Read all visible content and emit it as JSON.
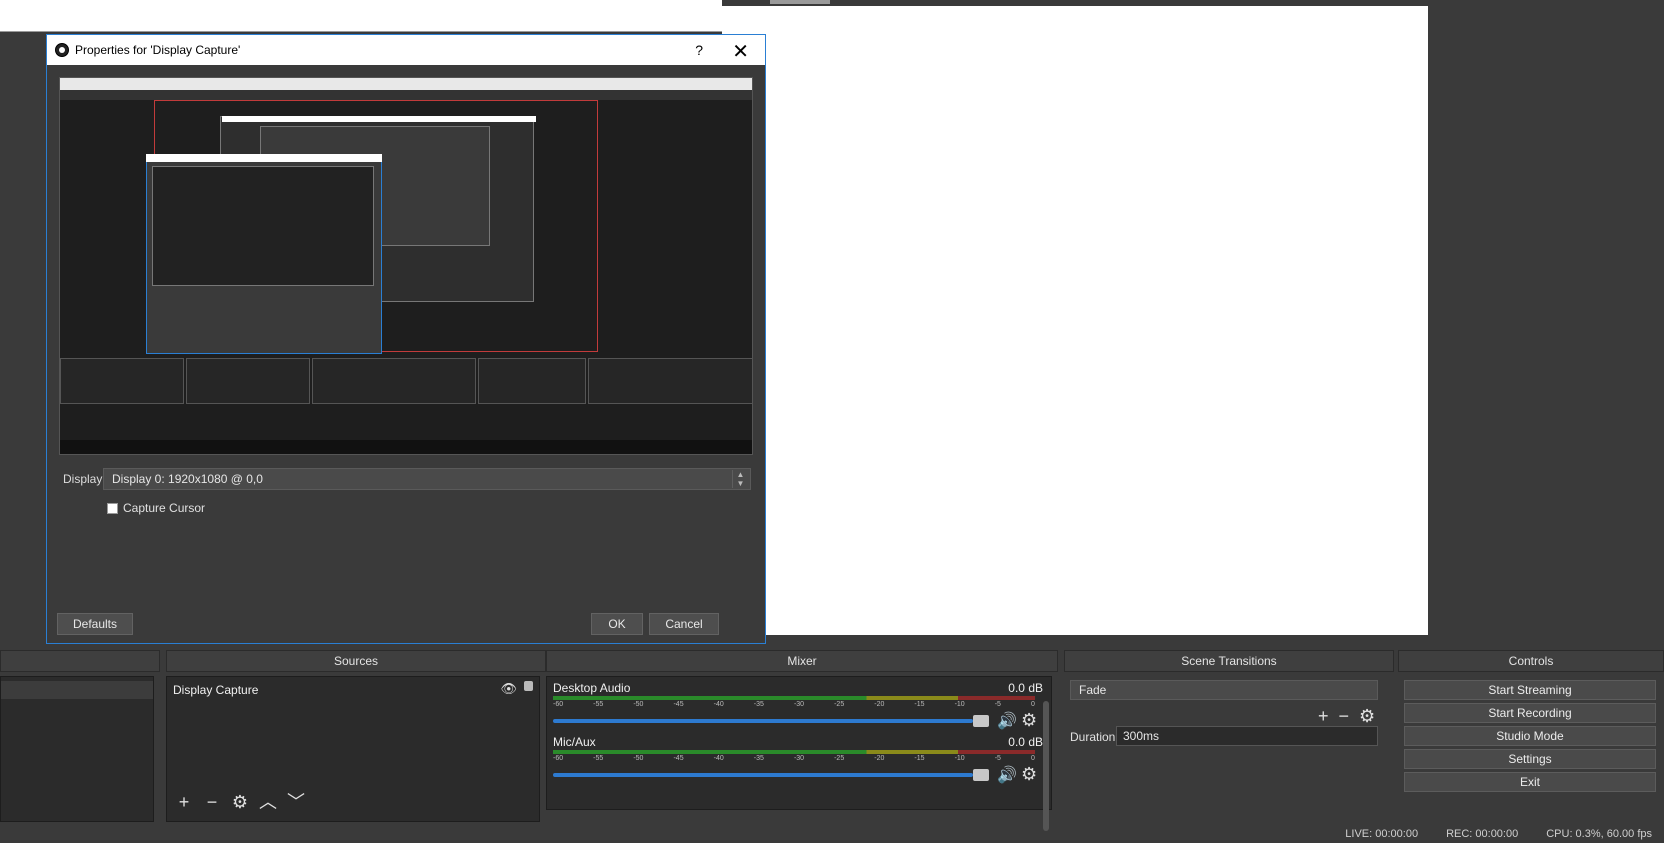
{
  "dialog": {
    "title": "Properties for 'Display Capture'",
    "help_glyph": "?",
    "close_glyph": "✕",
    "display_label": "Display",
    "display_value": "Display 0: 1920x1080 @ 0,0",
    "capture_cursor_label": "Capture Cursor",
    "defaults_label": "Defaults",
    "ok_label": "OK",
    "cancel_label": "Cancel"
  },
  "docks": {
    "sources_title": "Sources",
    "mixer_title": "Mixer",
    "transitions_title": "Scene Transitions",
    "controls_title": "Controls"
  },
  "sources": {
    "items": [
      "Display Capture"
    ]
  },
  "mixer": {
    "channels": [
      {
        "name": "Desktop Audio",
        "db": "0.0 dB"
      },
      {
        "name": "Mic/Aux",
        "db": "0.0 dB"
      }
    ],
    "ticks": [
      "-60",
      "-55",
      "-50",
      "-45",
      "-40",
      "-35",
      "-30",
      "-25",
      "-20",
      "-15",
      "-10",
      "-5",
      "0"
    ]
  },
  "transitions": {
    "selected": "Fade",
    "duration_label": "Duration",
    "duration_value": "300ms"
  },
  "controls": {
    "buttons": [
      "Start Streaming",
      "Start Recording",
      "Studio Mode",
      "Settings",
      "Exit"
    ]
  },
  "status": {
    "live": "LIVE: 00:00:00",
    "rec": "REC: 00:00:00",
    "cpu": "CPU: 0.3%, 60.00 fps"
  },
  "colors": {
    "dialog_border": "#2a7fd4",
    "fader_blue": "#2d7ad0",
    "background": "#3a3a3a"
  }
}
